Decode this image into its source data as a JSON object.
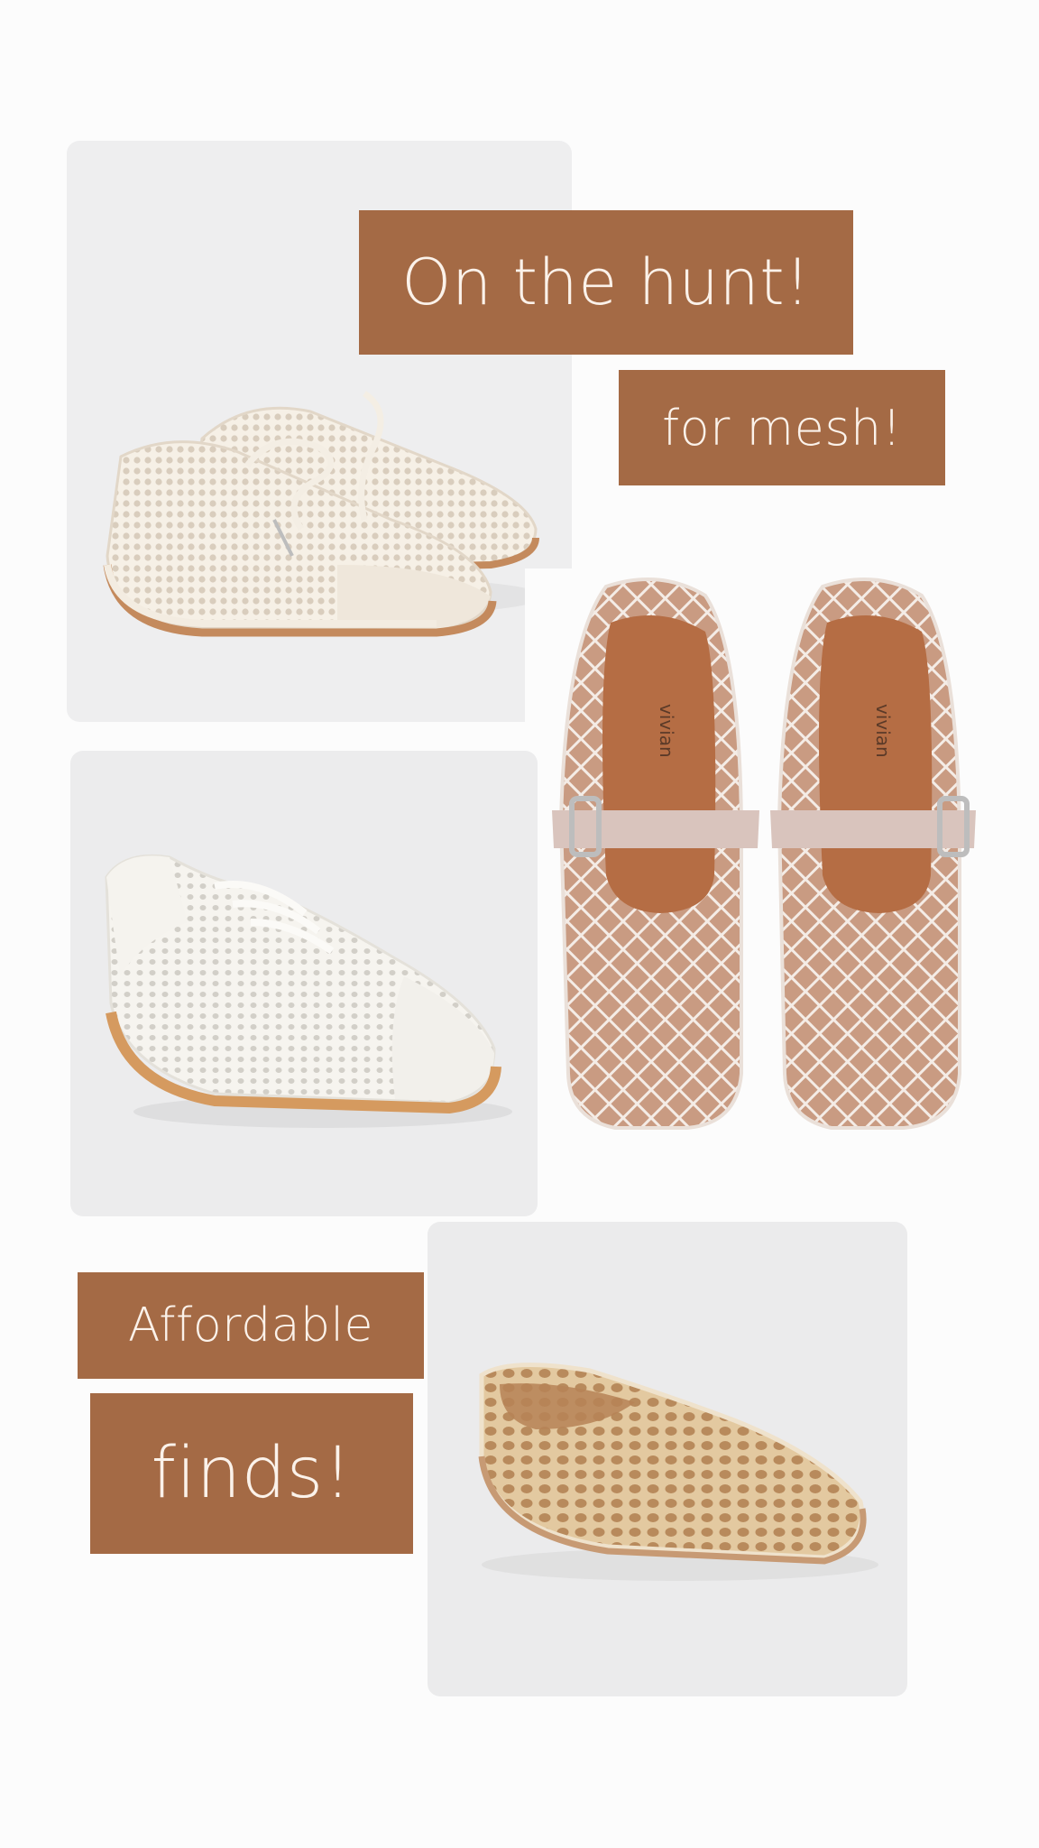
{
  "labels": {
    "on_the_hunt": "On the hunt!",
    "for_mesh": "for mesh!",
    "affordable": "Affordable",
    "finds": "finds!"
  },
  "products": [
    {
      "name": "mesh-lace-up-sneakers-icon",
      "color": "#ede3d6"
    },
    {
      "name": "perforated-white-sneaker-icon",
      "color": "#f3f1ec"
    },
    {
      "name": "mesh-mary-jane-flats-icon",
      "color": "#e9d3c8",
      "brand": "vivian"
    },
    {
      "name": "crochet-mesh-ballet-flat-icon",
      "color": "#e6d2ad"
    }
  ],
  "colors": {
    "accent": "#a46a45",
    "label_text": "#fbf2ea",
    "card_bg": "#ececed",
    "page_bg": "#fcfcfc"
  }
}
